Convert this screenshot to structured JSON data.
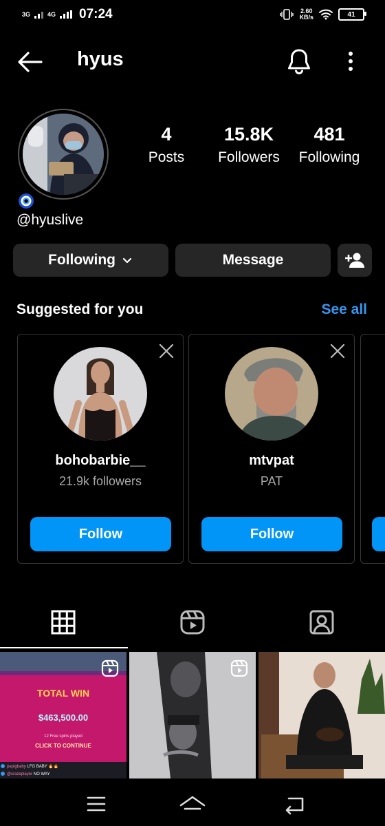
{
  "status_bar": {
    "net1": "3G",
    "net2": "4G",
    "time": "07:24",
    "speed_value": "2.60",
    "speed_unit": "KB/s",
    "battery": "41"
  },
  "header": {
    "title": "hyus",
    "icons": [
      "back-arrow-icon",
      "bell-icon",
      "more-vertical-icon"
    ]
  },
  "profile": {
    "stats": [
      {
        "num": "4",
        "label": "Posts"
      },
      {
        "num": "15.8K",
        "label": "Followers"
      },
      {
        "num": "481",
        "label": "Following"
      }
    ],
    "handle": "@hyuslive"
  },
  "actions": {
    "following_label": "Following",
    "message_label": "Message"
  },
  "suggested": {
    "title": "Suggested for you",
    "see_all": "See all",
    "cards": [
      {
        "name": "bohobarbie__",
        "sub": "21.9k followers",
        "button": "Follow"
      },
      {
        "name": "mtvpat",
        "sub": "PAT",
        "button": "Follow"
      }
    ]
  },
  "grid": {
    "tile1": {
      "headline": "TOTAL WIN",
      "amount": "$463,500.00",
      "small_note": "12 Free spins played",
      "cta": "CLICK TO CONTINUE",
      "chat": [
        {
          "user": "papigbaby",
          "msg": "LFG BABY 🔥🔥"
        },
        {
          "user": "@crazeplayer",
          "msg": "NO WAY"
        }
      ]
    }
  },
  "colors": {
    "accent": "#0095f6",
    "link": "#3797f0",
    "button_bg": "#262626",
    "border": "#363636",
    "muted_text": "#a8a8a8"
  }
}
